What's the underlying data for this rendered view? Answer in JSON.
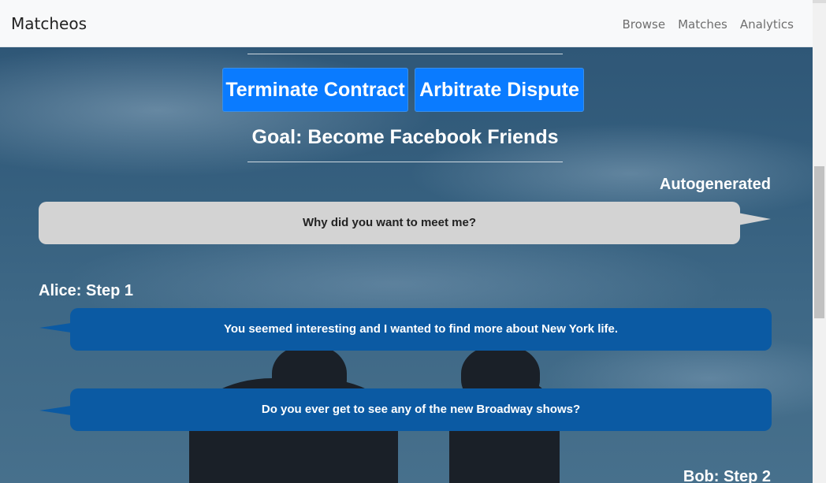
{
  "navbar": {
    "brand": "Matcheos",
    "links": [
      "Browse",
      "Matches",
      "Analytics"
    ]
  },
  "actions": {
    "terminate_label": "Terminate Contract",
    "arbitrate_label": "Arbitrate Dispute"
  },
  "goal": "Goal: Become Facebook Friends",
  "conversation": [
    {
      "speaker": "Autogenerated",
      "message": "Why did you want to meet me?"
    },
    {
      "speaker": "Alice: Step 1",
      "messages": [
        "You seemed interesting and I wanted to find more about New York life.",
        "Do you ever get to see any of the new Broadway shows?"
      ]
    },
    {
      "speaker": "Bob: Step 2"
    }
  ],
  "colors": {
    "primary_button": "#0a7bff",
    "blue_bubble": "#0b5aa3",
    "gray_bubble": "#d3d3d3"
  }
}
